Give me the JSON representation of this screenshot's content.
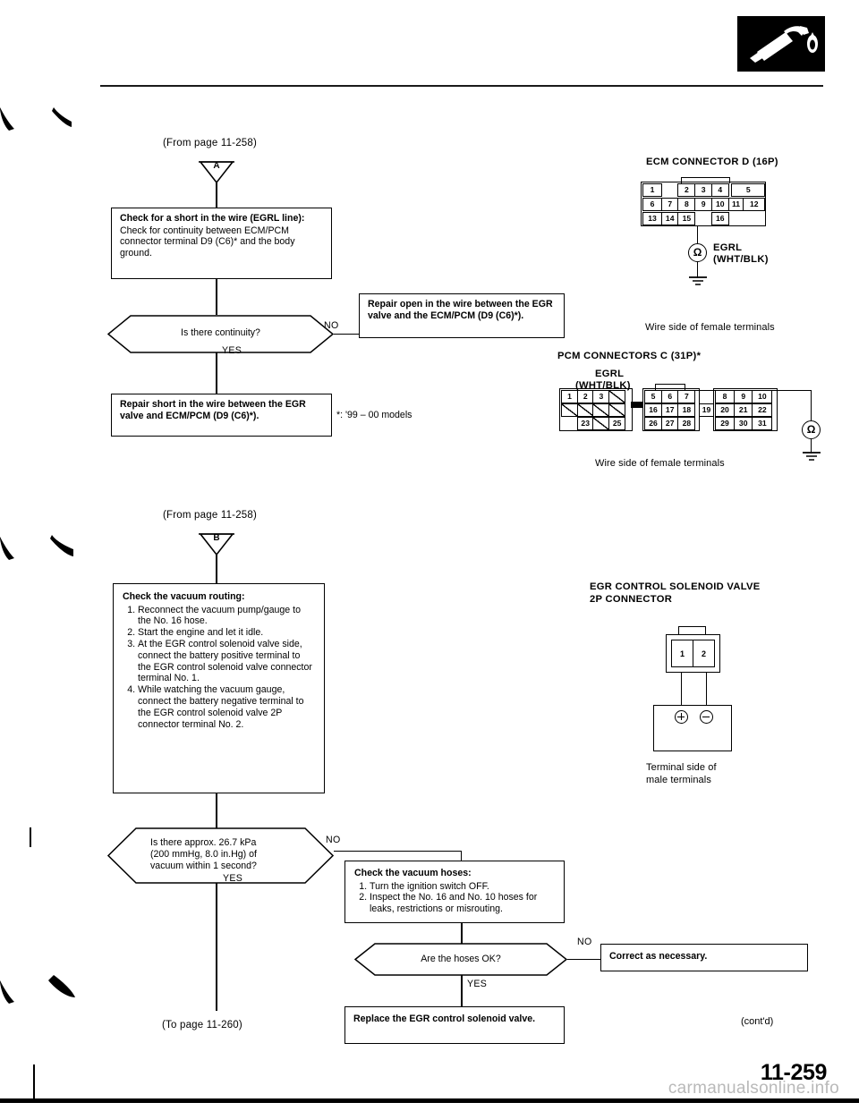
{
  "page": {
    "number": "11-259",
    "watermark": "carmanualsonline.info",
    "contd": "(cont'd)",
    "footnote": "*: '99 – 00 models",
    "logo_icon": "fuel-nozzle-icon"
  },
  "branch_a": {
    "from_page": "(From page 11-258)",
    "connector_letter": "A",
    "check_box": {
      "title": "Check for a short in the wire (EGRL line):",
      "body": "Check for continuity between ECM/PCM connector terminal D9 (C6)* and the body ground."
    },
    "decision": {
      "text": "Is there continuity?",
      "no_label": "NO",
      "yes_label": "YES"
    },
    "no_box": "Repair open in the wire between the EGR valve and the ECM/PCM (D9 (C6)*).",
    "yes_box": "Repair short in the wire between the EGR valve and ECM/PCM (D9 (C6)*)."
  },
  "branch_b": {
    "from_page": "(From page 11-258)",
    "connector_letter": "B",
    "check_box": {
      "title": "Check the vacuum routing:",
      "steps": [
        "Reconnect the vacuum pump/gauge to the No. 16 hose.",
        "Start the engine and let it idle.",
        "At the EGR control solenoid valve side, connect the battery positive terminal to the EGR control solenoid valve connector terminal No. 1.",
        "While watching the vacuum gauge, connect the battery negative terminal to the EGR control solenoid valve 2P connector terminal No. 2."
      ]
    },
    "decision": {
      "line1": "Is there approx. 26.7 kPa",
      "line2": "(200 mmHg, 8.0 in.Hg) of",
      "line3": "vacuum within 1 second?",
      "no_label": "NO",
      "yes_label": "YES"
    },
    "to_page": "(To page 11-260)",
    "hoses_box": {
      "title": "Check the vacuum hoses:",
      "steps": [
        "Turn the ignition switch OFF.",
        "Inspect the No. 16 and No. 10 hoses for leaks, restrictions or misrouting."
      ]
    },
    "hoses_decision": {
      "text": "Are the hoses OK?",
      "no_label": "NO",
      "yes_label": "YES"
    },
    "correct_box": "Correct as necessary.",
    "replace_box": "Replace the EGR control solenoid valve."
  },
  "ecm_connector": {
    "title": "ECM CONNECTOR D (16P)",
    "signal_name": "EGRL",
    "signal_color": "(WHT/BLK)",
    "meter_symbol": "Ω",
    "caption": "Wire side of female terminals",
    "rows": [
      [
        "1",
        "",
        "2",
        "3",
        "4",
        "",
        "5"
      ],
      [
        "6",
        "7",
        "8",
        "9",
        "10",
        "11",
        "12"
      ],
      [
        "13",
        "14",
        "15",
        "",
        "16",
        "",
        ""
      ]
    ]
  },
  "pcm_connector": {
    "title": "PCM CONNECTORS C (31P)*",
    "signal_name": "EGRL",
    "signal_color": "(WHT/BLK)",
    "meter_symbol": "Ω",
    "caption": "Wire side of female terminals",
    "group1": [
      [
        "1",
        "2",
        "3",
        "/"
      ],
      [
        "/",
        "/",
        "/",
        "/"
      ],
      [
        "",
        "23",
        "/",
        "25"
      ]
    ],
    "group2": [
      [
        "5",
        "6",
        "7"
      ],
      [
        "16",
        "17",
        "18"
      ],
      [
        "26",
        "27",
        "28"
      ]
    ],
    "group2b": [
      "",
      "19",
      ""
    ],
    "group3": [
      [
        "8",
        "9",
        "10"
      ],
      [
        "20",
        "21",
        "22"
      ],
      [
        "29",
        "30",
        "31"
      ]
    ]
  },
  "solenoid_connector": {
    "title_line1": "EGR CONTROL SOLENOID VALVE",
    "title_line2": "2P CONNECTOR",
    "pins": [
      "1",
      "2"
    ],
    "caption_line1": "Terminal side of",
    "caption_line2": "male terminals",
    "positive_symbol": "+",
    "negative_symbol": "−"
  }
}
